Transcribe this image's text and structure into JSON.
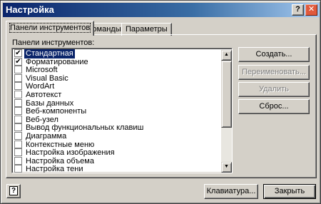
{
  "window": {
    "title": "Настройка",
    "help_glyph": "?",
    "close_glyph": "✕"
  },
  "tabs": [
    {
      "label": "Панели инструментов",
      "active": true
    },
    {
      "label": "Команды",
      "active": false
    },
    {
      "label": "Параметры",
      "active": false
    }
  ],
  "panel": {
    "list_label": "Панели инструментов:",
    "items": [
      {
        "label": "Стандартная",
        "checked": true,
        "selected": true
      },
      {
        "label": "Форматирование",
        "checked": true,
        "selected": false
      },
      {
        "label": "Microsoft",
        "checked": false,
        "selected": false
      },
      {
        "label": "Visual Basic",
        "checked": false,
        "selected": false
      },
      {
        "label": "WordArt",
        "checked": false,
        "selected": false
      },
      {
        "label": "Автотекст",
        "checked": false,
        "selected": false
      },
      {
        "label": "Базы данных",
        "checked": false,
        "selected": false
      },
      {
        "label": "Веб-компоненты",
        "checked": false,
        "selected": false
      },
      {
        "label": "Веб-узел",
        "checked": false,
        "selected": false
      },
      {
        "label": "Вывод функциональных клавиш",
        "checked": false,
        "selected": false
      },
      {
        "label": "Диаграмма",
        "checked": false,
        "selected": false
      },
      {
        "label": "Контекстные меню",
        "checked": false,
        "selected": false
      },
      {
        "label": "Настройка изображения",
        "checked": false,
        "selected": false
      },
      {
        "label": "Настройка объема",
        "checked": false,
        "selected": false
      },
      {
        "label": "Настройка тени",
        "checked": false,
        "selected": false
      }
    ],
    "check_glyph": "✔",
    "buttons": {
      "create": "Создать...",
      "rename": "Переименовать...",
      "delete": "Удалить",
      "reset": "Сброс..."
    }
  },
  "footer": {
    "help_glyph": "?",
    "keyboard": "Клавиатура...",
    "close": "Закрыть"
  },
  "scrollbar": {
    "up_glyph": "▲",
    "down_glyph": "▼"
  }
}
